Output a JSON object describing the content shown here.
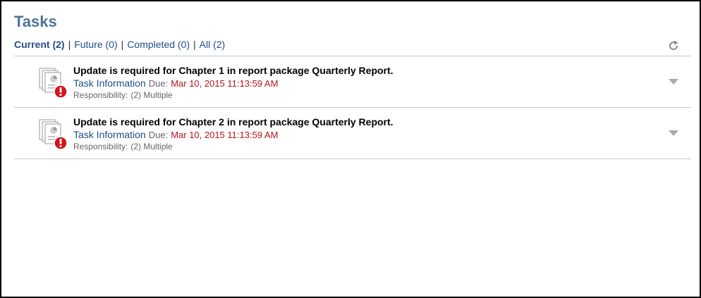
{
  "panel": {
    "title": "Tasks"
  },
  "filters": [
    {
      "label": "Current (2)",
      "active": true
    },
    {
      "label": "Future (0)",
      "active": false
    },
    {
      "label": "Completed (0)",
      "active": false
    },
    {
      "label": "All (2)",
      "active": false
    }
  ],
  "filter_separator": "|",
  "icons": {
    "refresh": "refresh-icon",
    "task": "document-stack-icon",
    "alert": "alert-icon",
    "expand": "chevron-down-icon"
  },
  "colors": {
    "title": "#4f7399",
    "link": "#1f4d8a",
    "due": "#b8141c",
    "alert": "#d2141e"
  },
  "tasks": [
    {
      "heading": "Update is required for Chapter 1 in report package Quarterly Report.",
      "link_label": "Task Information",
      "due_label": "Due:",
      "due_value": "Mar 10, 2015 11:13:59 AM",
      "responsibility_label": "Responsibility:",
      "responsibility_value": "(2) Multiple"
    },
    {
      "heading": "Update is required for Chapter 2 in report package Quarterly Report.",
      "link_label": "Task Information",
      "due_label": "Due:",
      "due_value": "Mar 10, 2015 11:13:59 AM",
      "responsibility_label": "Responsibility:",
      "responsibility_value": "(2) Multiple"
    }
  ]
}
